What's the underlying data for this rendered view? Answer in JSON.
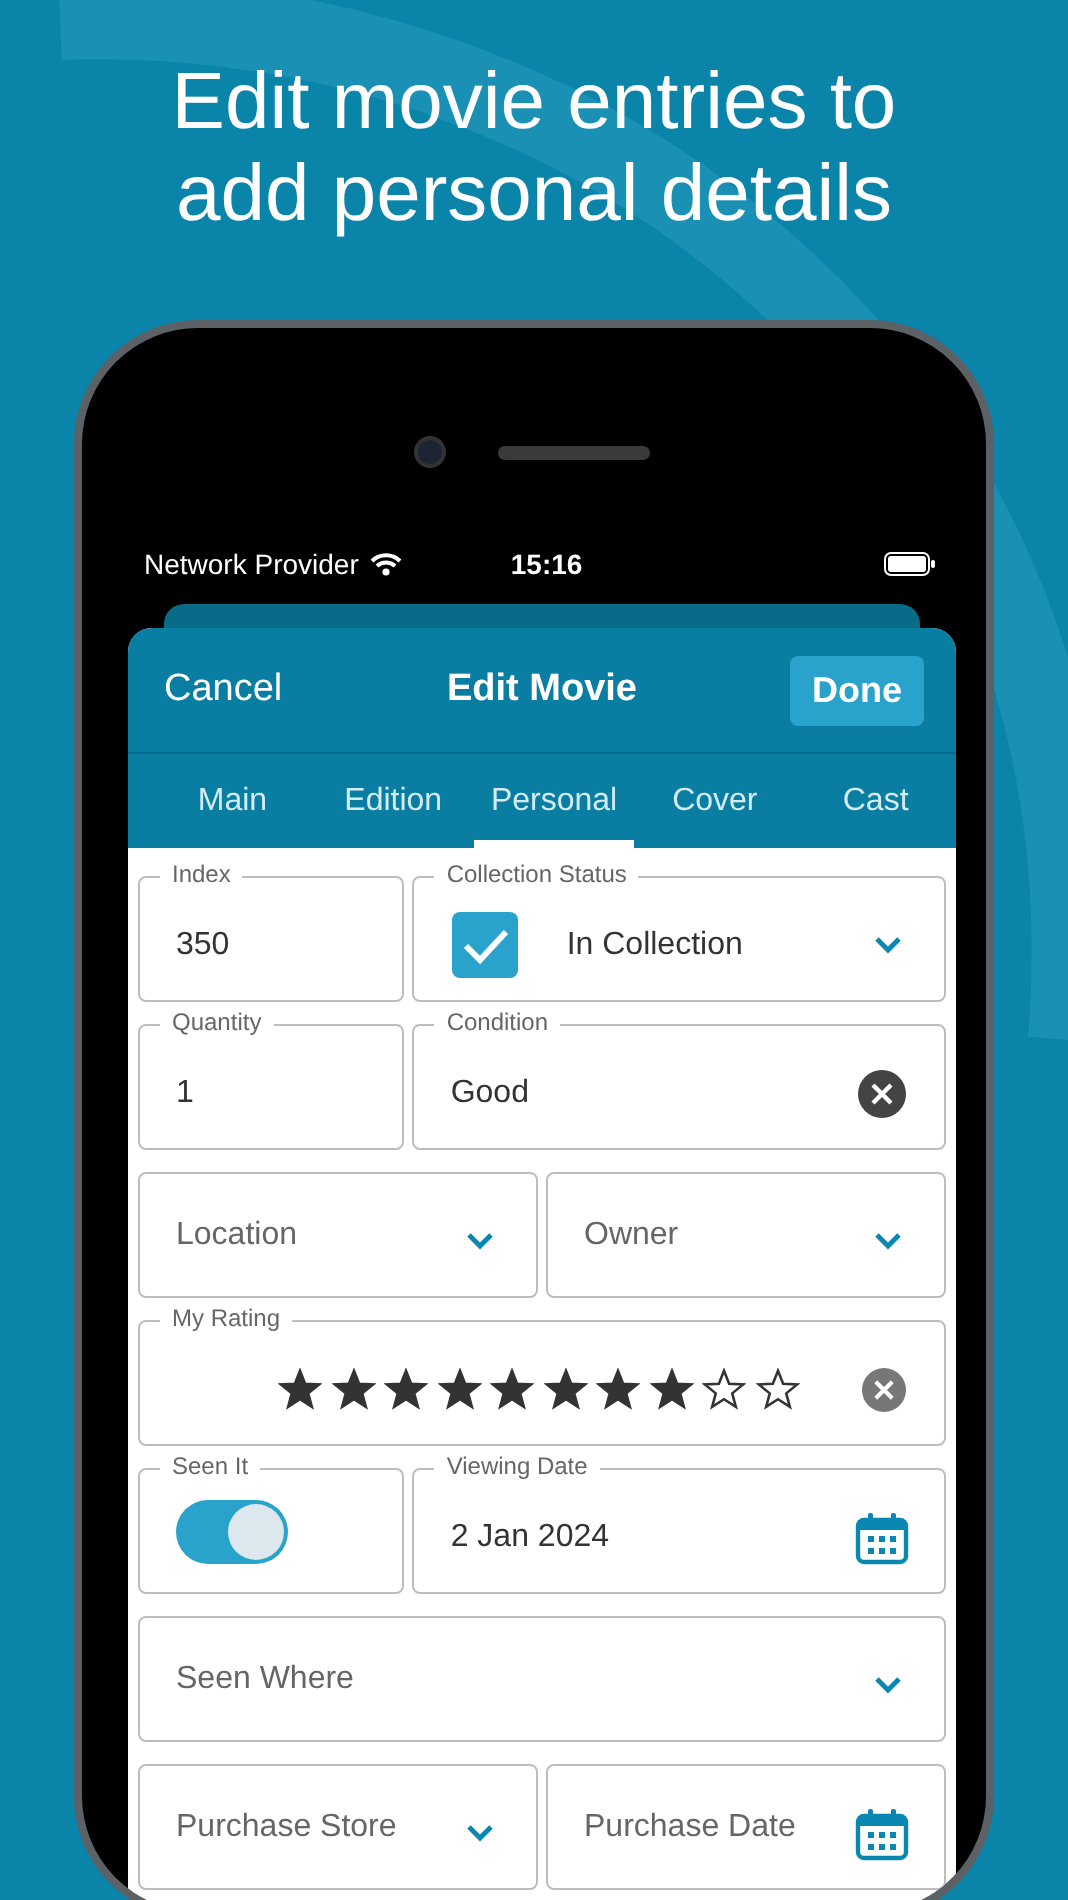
{
  "headline": "Edit movie entries to add personal details",
  "status_bar": {
    "carrier": "Network Provider",
    "time": "15:16"
  },
  "header": {
    "cancel": "Cancel",
    "title": "Edit Movie",
    "done": "Done"
  },
  "tabs": [
    {
      "label": "Main",
      "selected": false
    },
    {
      "label": "Edition",
      "selected": false
    },
    {
      "label": "Personal",
      "selected": true
    },
    {
      "label": "Cover",
      "selected": false
    },
    {
      "label": "Cast",
      "selected": false
    }
  ],
  "rows": [
    [
      {
        "kind": "text",
        "label": "Index",
        "value": "350"
      },
      {
        "kind": "status",
        "label": "Collection Status",
        "checked": true,
        "value": "In Collection"
      }
    ],
    [
      {
        "kind": "text",
        "label": "Quantity",
        "value": "1"
      },
      {
        "kind": "clearable",
        "label": "Condition",
        "value": "Good"
      }
    ],
    [
      {
        "kind": "select",
        "placeholder": "Location"
      },
      {
        "kind": "select",
        "placeholder": "Owner"
      }
    ],
    [
      {
        "kind": "rating",
        "label": "My Rating",
        "stars": 8
      }
    ],
    [
      {
        "kind": "toggle",
        "label": "Seen It",
        "on": true
      },
      {
        "kind": "date",
        "label": "Viewing Date",
        "value": "2 Jan 2024"
      }
    ],
    [
      {
        "kind": "select",
        "placeholder": "Seen Where"
      }
    ],
    [
      {
        "kind": "select",
        "placeholder": "Purchase Store"
      },
      {
        "kind": "date",
        "placeholder": "Purchase Date"
      }
    ]
  ]
}
